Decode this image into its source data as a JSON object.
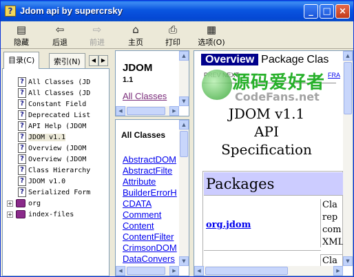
{
  "window": {
    "title": "Jdom api by supercrsky",
    "icon_glyph": "?"
  },
  "titlebar_buttons": {
    "minimize": "_",
    "maximize": "□",
    "close": "×"
  },
  "toolbar": [
    {
      "label": "隐藏",
      "icon": "hide-icon",
      "glyph": "▤",
      "disabled": false
    },
    {
      "label": "后退",
      "icon": "back-icon",
      "glyph": "⇦",
      "disabled": false
    },
    {
      "label": "前进",
      "icon": "forward-icon",
      "glyph": "⇨",
      "disabled": true
    },
    {
      "label": "主页",
      "icon": "home-icon",
      "glyph": "⌂",
      "disabled": false
    },
    {
      "label": "打印",
      "icon": "print-icon",
      "glyph": "⎙",
      "disabled": false
    },
    {
      "label": "选项(O)",
      "icon": "options-icon",
      "glyph": "▦",
      "disabled": false
    }
  ],
  "nav_tabs": [
    {
      "label": "目录(C)",
      "active": true
    },
    {
      "label": "索引(N)",
      "active": false
    }
  ],
  "tree_items": [
    {
      "label": "All Classes (JD",
      "type": "doc",
      "selected": false
    },
    {
      "label": "All Classes (JD",
      "type": "doc",
      "selected": false
    },
    {
      "label": "Constant Field",
      "type": "doc",
      "selected": false
    },
    {
      "label": "Deprecated List",
      "type": "doc",
      "selected": false
    },
    {
      "label": "API Help (JDOM",
      "type": "doc",
      "selected": false
    },
    {
      "label": "JDOM v1.1",
      "type": "doc",
      "selected": true
    },
    {
      "label": "Overview (JDOM",
      "type": "doc",
      "selected": false
    },
    {
      "label": "Overview (JDOM",
      "type": "doc",
      "selected": false
    },
    {
      "label": "Class Hierarchy",
      "type": "doc",
      "selected": false
    },
    {
      "label": "JDOM v1.0",
      "type": "doc",
      "selected": false
    },
    {
      "label": "Serialized Form",
      "type": "doc",
      "selected": false
    },
    {
      "label": "org",
      "type": "book",
      "selected": false
    },
    {
      "label": "index-files",
      "type": "book",
      "selected": false
    }
  ],
  "package_frame": {
    "title": "JDOM",
    "version": "1.1",
    "all_classes_link": "All Classes"
  },
  "classes_frame": {
    "heading": "All Classes",
    "classes": [
      "AbstractDOM",
      "AbstractFilte",
      "Attribute",
      "BuilderErrorH",
      "CDATA",
      "Comment",
      "Content",
      "ContentFilter",
      "CrimsonDOM",
      "DataConvers"
    ]
  },
  "content": {
    "navbar": [
      "Overview",
      "Package",
      "Clas"
    ],
    "subnav": "PREV  NEXT",
    "frames_link": "FRA",
    "spec_title_lines": [
      "JDOM v1.1",
      "API",
      "Specification"
    ],
    "packages_heading": "Packages",
    "package_rows": [
      {
        "name": "org.jdom",
        "desc_lines": [
          "Cla",
          "rep",
          "com",
          "XML"
        ]
      }
    ],
    "next_row_desc": "Cla"
  },
  "watermark": {
    "main": "源码爱好者",
    "sub": "CodeFans.net"
  },
  "colors": {
    "title_bar": "#0a55e0",
    "link": "#0000ee",
    "visited_link": "#7a2b7a",
    "table_header": "#ccccff",
    "navbar_active": "#00008b",
    "watermark_green": "#27b02a"
  }
}
